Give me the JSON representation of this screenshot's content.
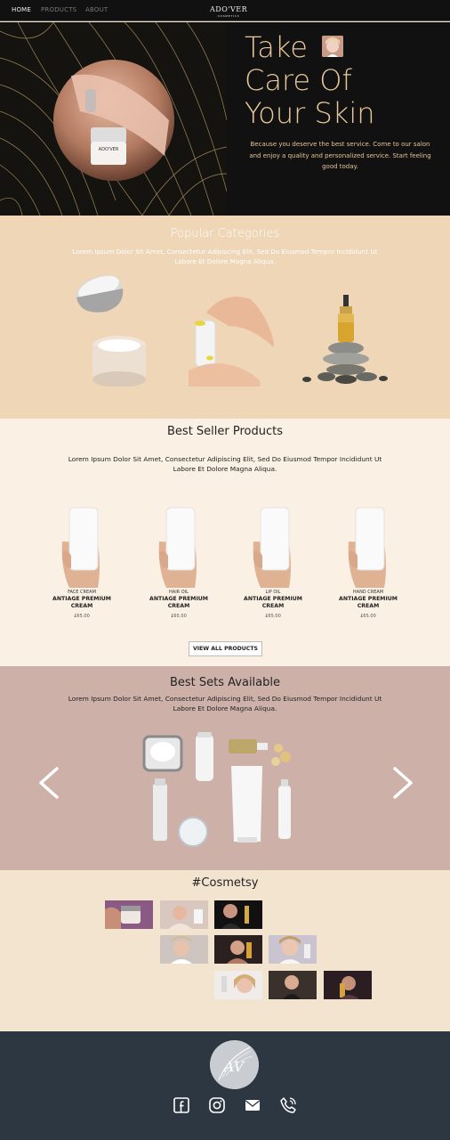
{
  "nav": {
    "home": "HOME",
    "products": "PRODUCTS",
    "about": "ABOUT",
    "logo_main": "ADO'VER",
    "logo_sub": "COSMETICS"
  },
  "hero": {
    "title_line1": "Take",
    "title_line2": "Care Of",
    "title_line3": "Your Skin",
    "description": "Because you deserve the best service. Come to our salon and enjoy a quality and personalized service. Start feeling good today.",
    "jar_label": "ADO'VER"
  },
  "popular": {
    "title": "Popular Categories",
    "subtitle": "Lorem Ipsum Dolor Sit Amet, Consectetur Adipiscing Elit, Sed Do Eiusmod  Tempor Incididunt Ut Labore Et Dolore Magna Aliqua."
  },
  "bestseller": {
    "title": "Best Seller Products",
    "subtitle": "Lorem Ipsum Dolor Sit Amet, Consectetur Adipiscing Elit, Sed Do Eiusmod  Tempor Incididunt Ut Labore Et Dolore Magna Aliqua.",
    "products": [
      {
        "category": "FACE CREAM",
        "name_line1": "ANTIAGE PREMIUM",
        "name_line2": "CREAM",
        "price": "£65.00"
      },
      {
        "category": "HAIR OIL",
        "name_line1": "ANTIAGE PREMIUM",
        "name_line2": "CREAM",
        "price": "£65.00"
      },
      {
        "category": "LIP OIL",
        "name_line1": "ANTIAGE PREMIUM",
        "name_line2": "CREAM",
        "price": "£65.00"
      },
      {
        "category": "HAND CREAM",
        "name_line1": "ANTIAGE PREMIUM",
        "name_line2": "CREAM",
        "price": "£65.00"
      }
    ],
    "view_all": "VIEW ALL PRODUCTS"
  },
  "sets": {
    "title": "Best Sets Available",
    "subtitle": "Lorem Ipsum Dolor Sit Amet, Consectetur Adipiscing Elit, Sed Do Eiusmod  Tempor Incididunt Ut Labore Et Dolore Magna Aliqua."
  },
  "cosmetsy": {
    "title": "#Cosmetsy"
  },
  "footer": {
    "logo_text": "AV"
  },
  "colors": {
    "hero_gold": "#e7c79b",
    "popular_bg": "#eed6b7",
    "bestseller_bg": "#fbf0e4",
    "sets_bg": "#cdb1a9",
    "footer_bg": "#2d3741"
  },
  "icons": [
    "facebook-icon",
    "instagram-icon",
    "mail-icon",
    "phone-icon",
    "chevron-left-icon",
    "chevron-right-icon"
  ]
}
